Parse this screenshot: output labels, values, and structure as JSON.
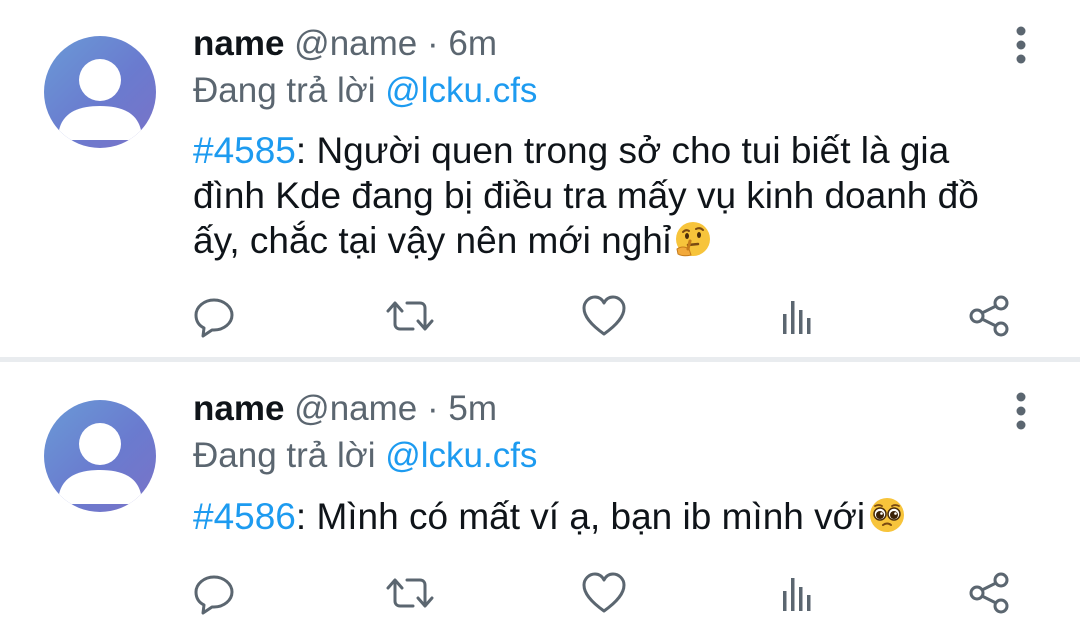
{
  "colors": {
    "text": "#0f1419",
    "secondary": "#5b6670",
    "accent": "#1d9bf0",
    "icon": "#5b6670",
    "divider": "#e9ecef"
  },
  "tweets": [
    {
      "display_name": "name",
      "handle": "@name",
      "separator": "·",
      "time": "6m",
      "reply_prefix": "Đang trả lời",
      "reply_to": "@lcku.cfs",
      "hashtag": "#4585",
      "text": ": Người quen trong sở cho tui biết là gia đình Kde đang bị điều tra mấy vụ kinh doanh đồ ấy, chắc tại vậy nên mới nghỉ",
      "emoji": "thinking-face-emoji"
    },
    {
      "display_name": "name",
      "handle": "@name",
      "separator": "·",
      "time": "5m",
      "reply_prefix": "Đang trả lời",
      "reply_to": "@lcku.cfs",
      "hashtag": "#4586",
      "text": ": Mình có mất ví ạ, bạn ib mình với",
      "emoji": "pleading-face-emoji"
    }
  ],
  "actions": [
    "reply-icon",
    "retweet-icon",
    "like-icon",
    "analytics-icon",
    "share-icon"
  ]
}
